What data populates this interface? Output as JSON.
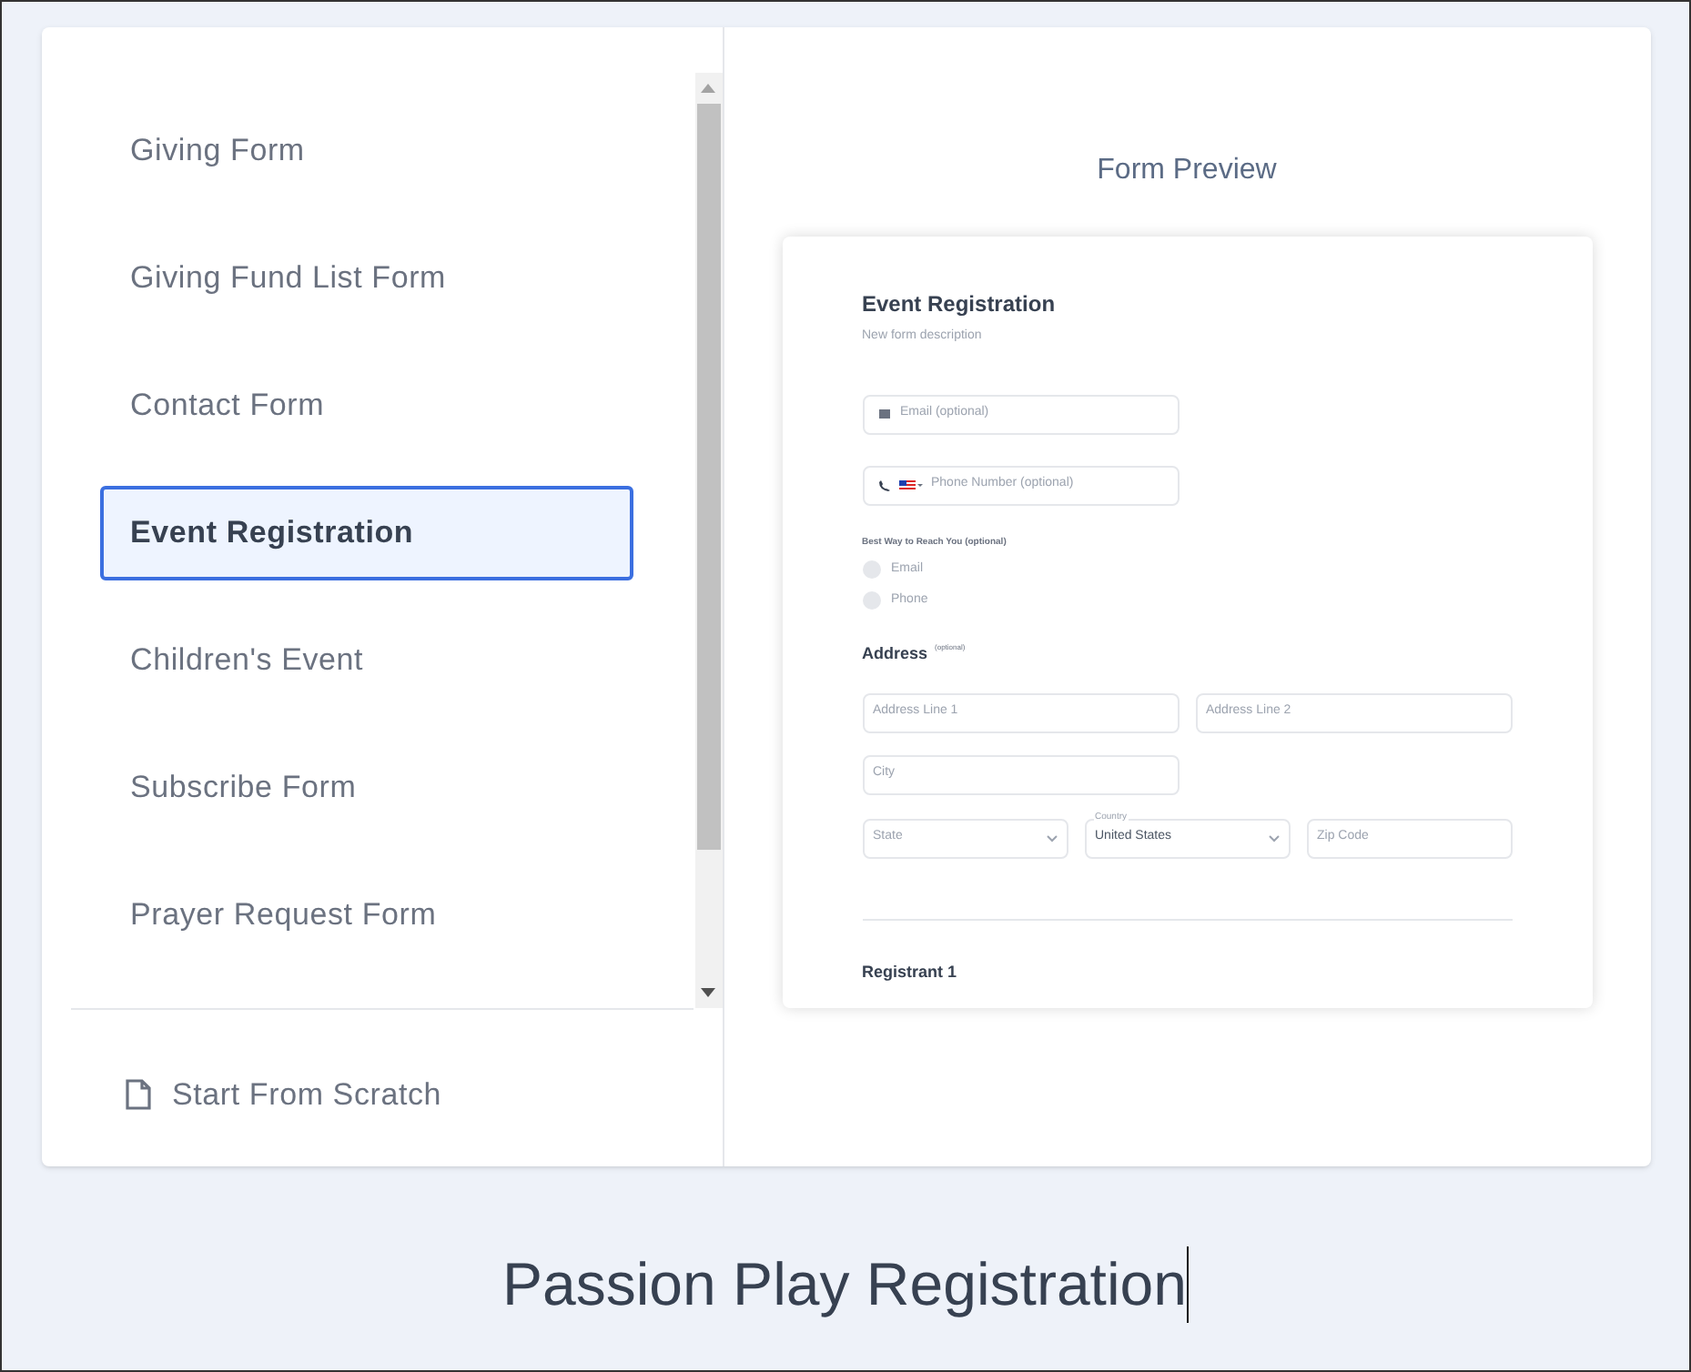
{
  "templates": [
    {
      "label": "Giving Form",
      "selected": false
    },
    {
      "label": "Giving Fund List Form",
      "selected": false
    },
    {
      "label": "Contact Form",
      "selected": false
    },
    {
      "label": "Event Registration",
      "selected": true
    },
    {
      "label": "Children's Event",
      "selected": false
    },
    {
      "label": "Subscribe Form",
      "selected": false
    },
    {
      "label": "Prayer Request Form",
      "selected": false
    }
  ],
  "start_from_scratch": "Start From Scratch",
  "preview": {
    "heading": "Form Preview",
    "form_title": "Event Registration",
    "description": "New form description",
    "email_placeholder": "Email  (optional)",
    "phone_placeholder": "Phone Number  (optional)",
    "reach_label": "Best Way to Reach You",
    "reach_optional": "(optional)",
    "reach_options": [
      {
        "label": "Email",
        "selected": false
      },
      {
        "label": "Phone",
        "selected": false
      }
    ],
    "address_heading": "Address",
    "address_optional": "(optional)",
    "address_line1": "Address Line 1",
    "address_line2": "Address Line 2",
    "city": "City",
    "state": "State",
    "country_label": "Country",
    "country_value": "United States",
    "zip": "Zip Code",
    "next_section": "Registrant 1"
  },
  "form_name": "Passion Play Registration"
}
